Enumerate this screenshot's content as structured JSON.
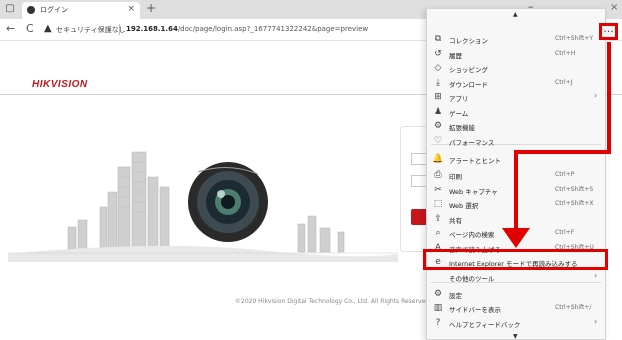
{
  "browser": {
    "tab_title": "ログイン",
    "tab_close": "×",
    "new_tab": "+",
    "minimize": "–",
    "close_window": "×",
    "nav_back": "←",
    "nav_reload": "C",
    "security_warning": "セキュリティ保護なし",
    "url_host": "192.168.1.64",
    "url_path": "/doc/page/login.asp?_1677741322242&page=preview",
    "more_button": "···"
  },
  "page": {
    "logo": "HIKVISION",
    "copyright": "©2020 Hikvision Digital Technology Co., Ltd. All Rights Reserved."
  },
  "menu": {
    "items": [
      {
        "icon": "collections-icon",
        "glyph": "⧉",
        "label": "コレクション",
        "shortcut": "Ctrl+Shift+Y",
        "arrow": ""
      },
      {
        "icon": "history-icon",
        "glyph": "↺",
        "label": "履歴",
        "shortcut": "Ctrl+H",
        "arrow": ""
      },
      {
        "icon": "shopping-icon",
        "glyph": "◇",
        "label": "ショッピング",
        "shortcut": "",
        "arrow": ""
      },
      {
        "icon": "download-icon",
        "glyph": "⤓",
        "label": "ダウンロード",
        "shortcut": "Ctrl+J",
        "arrow": ""
      },
      {
        "icon": "apps-icon",
        "glyph": "⊞",
        "label": "アプリ",
        "shortcut": "",
        "arrow": "›"
      },
      {
        "icon": "games-icon",
        "glyph": "♟",
        "label": "ゲーム",
        "shortcut": "",
        "arrow": ""
      },
      {
        "icon": "extensions-icon",
        "glyph": "⚙",
        "label": "拡張機能",
        "shortcut": "",
        "arrow": ""
      },
      {
        "icon": "performance-icon",
        "glyph": "♡",
        "label": "パフォーマンス",
        "shortcut": "",
        "arrow": ""
      },
      {
        "icon": "alerts-icon",
        "glyph": "🔔",
        "label": "アラートとヒント",
        "shortcut": "",
        "arrow": ""
      },
      {
        "icon": "print-icon",
        "glyph": "⎙",
        "label": "印刷",
        "shortcut": "Ctrl+P",
        "arrow": ""
      },
      {
        "icon": "web-capture-icon",
        "glyph": "✂",
        "label": "Web キャプチャ",
        "shortcut": "Ctrl+Shift+S",
        "arrow": ""
      },
      {
        "icon": "web-select-icon",
        "glyph": "⬚",
        "label": "Web 選択",
        "shortcut": "Ctrl+Shift+X",
        "arrow": ""
      },
      {
        "icon": "share-icon",
        "glyph": "⇪",
        "label": "共有",
        "shortcut": "",
        "arrow": ""
      },
      {
        "icon": "find-icon",
        "glyph": "⌕",
        "label": "ページ内の検索",
        "shortcut": "Ctrl+F",
        "arrow": ""
      },
      {
        "icon": "read-aloud-icon",
        "glyph": "A",
        "label": "音声で読み上げる",
        "shortcut": "Ctrl+Shift+U",
        "arrow": ""
      },
      {
        "icon": "ie-mode-icon",
        "glyph": "e",
        "label": "Internet Explorer モードで再読み込みする",
        "shortcut": "",
        "arrow": ""
      },
      {
        "icon": "more-tools-icon",
        "glyph": "",
        "label": "その他のツール",
        "shortcut": "",
        "arrow": "›"
      },
      {
        "icon": "settings-icon",
        "glyph": "⚙",
        "label": "設定",
        "shortcut": "",
        "arrow": ""
      },
      {
        "icon": "sidebar-icon",
        "glyph": "▥",
        "label": "サイドバーを表示",
        "shortcut": "Ctrl+Shift+/",
        "arrow": ""
      },
      {
        "icon": "help-icon",
        "glyph": "?",
        "label": "ヘルプとフィードバック",
        "shortcut": "",
        "arrow": "›"
      }
    ]
  },
  "colors": {
    "annotation_red": "#e00000",
    "brand_red": "#c8161d",
    "menu_bg": "#f7f7f7"
  }
}
